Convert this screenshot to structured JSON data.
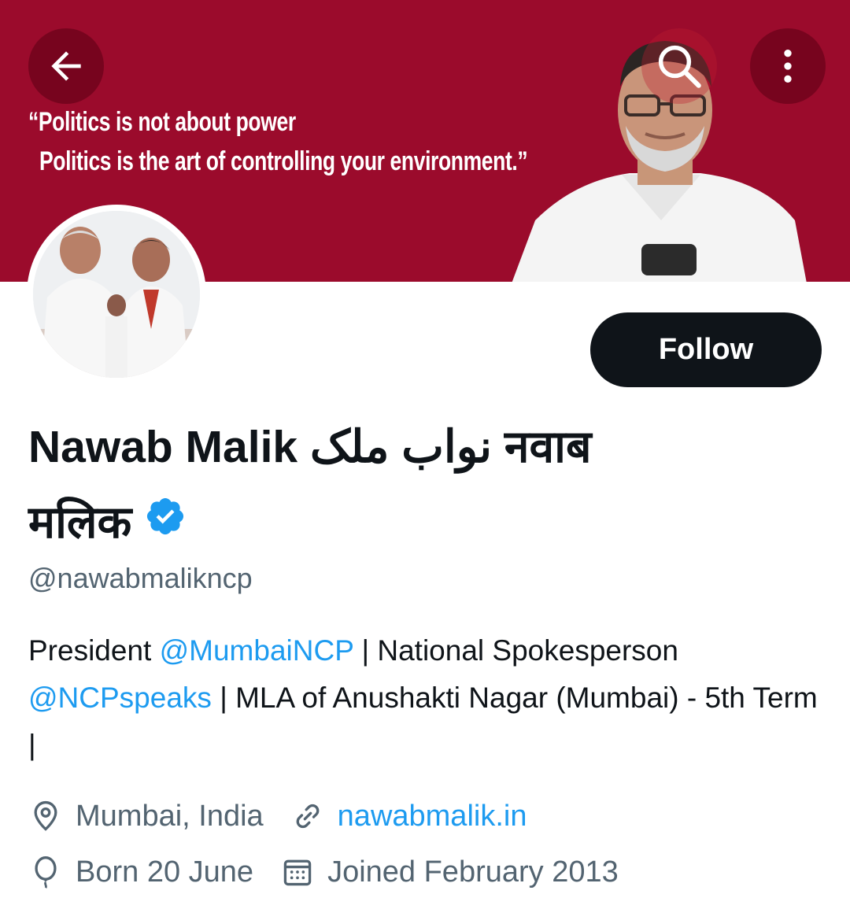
{
  "banner": {
    "quote_line1": "“Politics is not about power",
    "quote_line2": "  Politics is the art of controlling your environment.”",
    "background": "#9b0b2c"
  },
  "nav": {
    "back_icon": "arrow-left-icon",
    "search_icon": "search-icon",
    "more_icon": "more-vertical-icon"
  },
  "profile": {
    "follow_label": "Follow",
    "name_line1": "Nawab Malik نواب ملک नवाब",
    "name_line2": "मलिक",
    "verified_icon": "verified-badge-icon",
    "handle": "@nawabmalikncp",
    "bio": {
      "p1": "President ",
      "m1": "@MumbaiNCP",
      "p2": " | National Spokesperson ",
      "m2": "@NCPspeaks",
      "p3": " | MLA of Anushakti Nagar (Mumbai) - 5th Term |"
    },
    "location": "Mumbai, India",
    "website": "nawabmalik.in",
    "born": "Born 20 June",
    "joined": "Joined February 2013"
  },
  "colors": {
    "accent": "#1d9bf0",
    "text_primary": "#0f1419",
    "text_secondary": "#536471"
  }
}
